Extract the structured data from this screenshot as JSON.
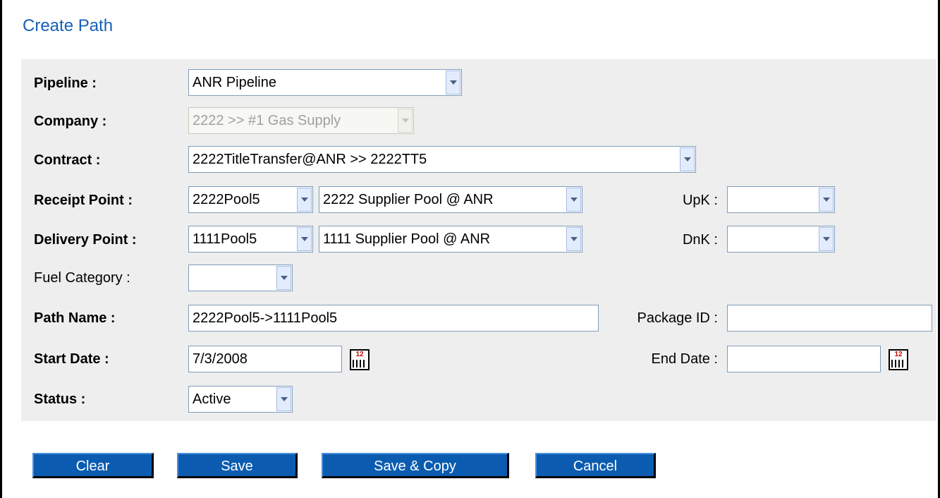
{
  "page": {
    "title": "Create Path"
  },
  "labels": {
    "pipeline": "Pipeline :",
    "company": "Company :",
    "contract": "Contract :",
    "receipt_point": "Receipt Point :",
    "delivery_point": "Delivery Point :",
    "fuel_category": "Fuel Category :",
    "path_name": "Path Name :",
    "start_date": "Start Date :",
    "status": "Status :",
    "upk": "UpK :",
    "dnk": "DnK :",
    "package_id": "Package ID :",
    "end_date": "End Date :"
  },
  "fields": {
    "pipeline": "ANR Pipeline",
    "company": "2222 >> #1 Gas Supply",
    "contract": "2222TitleTransfer@ANR >> 2222TT5",
    "receipt_point_code": "2222Pool5",
    "receipt_point_name": "2222 Supplier Pool @ ANR",
    "delivery_point_code": "1111Pool5",
    "delivery_point_name": "1111 Supplier Pool @ ANR",
    "upk": "",
    "dnk": "",
    "fuel_category": "",
    "path_name": "2222Pool5->1111Pool5",
    "package_id": "",
    "start_date": "7/3/2008",
    "end_date": "",
    "status": "Active"
  },
  "calendar_icon": {
    "text": "12",
    "icon": "calendar-icon"
  },
  "buttons": {
    "clear": "Clear",
    "save": "Save",
    "save_copy": "Save & Copy",
    "cancel": "Cancel"
  }
}
